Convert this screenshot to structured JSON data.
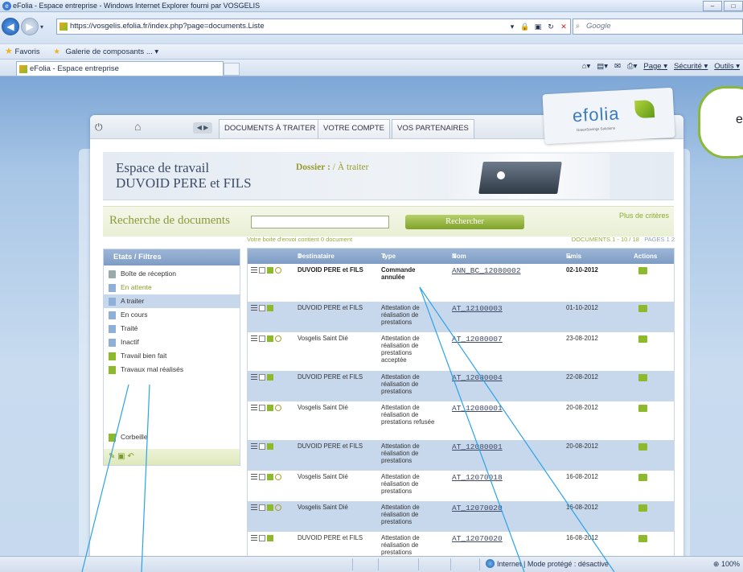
{
  "browser": {
    "title": "eFolia - Espace entreprise - Windows Internet Explorer fourni par VOSGELIS",
    "url": "https://vosgelis.efolia.fr/index.php?page=documents.Liste",
    "search_placeholder": "Google",
    "favorites_label": "Favoris",
    "gallery_label": "Galerie de composants ...",
    "tab_label": "eFolia - Espace entreprise",
    "cmd_page": "Page",
    "cmd_security": "Sécurité",
    "cmd_tools": "Outils",
    "status_zone": "Internet | Mode protégé : désactivé",
    "zoom": "100%"
  },
  "topnav": {
    "tabs": [
      "DOCUMENTS À TRAITER",
      "VOTRE COMPTE",
      "VOS PARTENAIRES"
    ]
  },
  "logo": {
    "text": "efolia",
    "tagline": "GreenSavings Solutions"
  },
  "cloud_text": "e",
  "header": {
    "title_line1": "Espace de travail",
    "title_line2": "DUVOID PERE et FILS",
    "dossier_label": "Dossier :",
    "dossier_value": " / À traiter"
  },
  "search": {
    "label": "Recherche de documents",
    "button": "Rechercher",
    "more": "Plus de critères"
  },
  "sidebar": {
    "header": "Etats / Filtres",
    "items": [
      "Boîte de réception",
      "En attente",
      "A traiter",
      "En cours",
      "Traité",
      "Inactif",
      "Travail bien fait",
      "Travaux mal réalisés"
    ],
    "trash": "Corbeille"
  },
  "table": {
    "info_left": "Votre boite d'envoi contient 0 document",
    "info_docs": "DOCUMENTS 1 - 10 / 18",
    "info_pages": "PAGES 1 2",
    "headers": {
      "dest": "Destinataire",
      "type": "Type",
      "nom": "Nom",
      "date": "Emis le",
      "actions": "Actions"
    },
    "rows": [
      {
        "dest": "DUVOID PERE et FILS",
        "type": "Commande annulée",
        "nom": "ANN_BC_12080002",
        "date": "02-10-2012"
      },
      {
        "dest": "DUVOID PERE et FILS",
        "type": "Attestation de réalisation de prestations",
        "nom": "AT_12100003",
        "date": "01-10-2012"
      },
      {
        "dest": "Vosgelis Saint Dié",
        "type": "Attestation de réalisation de prestations acceptée",
        "nom": "AT_12080007",
        "date": "23-08-2012"
      },
      {
        "dest": "DUVOID PERE et FILS",
        "type": "Attestation de réalisation de prestations",
        "nom": "AT_12080004",
        "date": "22-08-2012"
      },
      {
        "dest": "Vosgelis Saint Dié",
        "type": "Attestation de réalisation de prestations refusée",
        "nom": "AT_12080001",
        "date": "20-08-2012"
      },
      {
        "dest": "DUVOID PERE et FILS",
        "type": "Attestation de réalisation de prestations",
        "nom": "AT_12080001",
        "date": "20-08-2012"
      },
      {
        "dest": "Vosgelis Saint Dié",
        "type": "Attestation de réalisation de prestations",
        "nom": "AT_12070018",
        "date": "16-08-2012"
      },
      {
        "dest": "Vosgelis Saint Dié",
        "type": "Attestation de réalisation de prestations",
        "nom": "AT_12070020",
        "date": "16-08-2012"
      },
      {
        "dest": "DUVOID PERE et FILS",
        "type": "Attestation de réalisation de prestations",
        "nom": "AT_12070020",
        "date": "16-08-2012"
      }
    ]
  },
  "colors": {
    "accent_blue": "#7e9cc4",
    "accent_green": "#8cba2a",
    "row_alt": "#c7d7ec"
  }
}
